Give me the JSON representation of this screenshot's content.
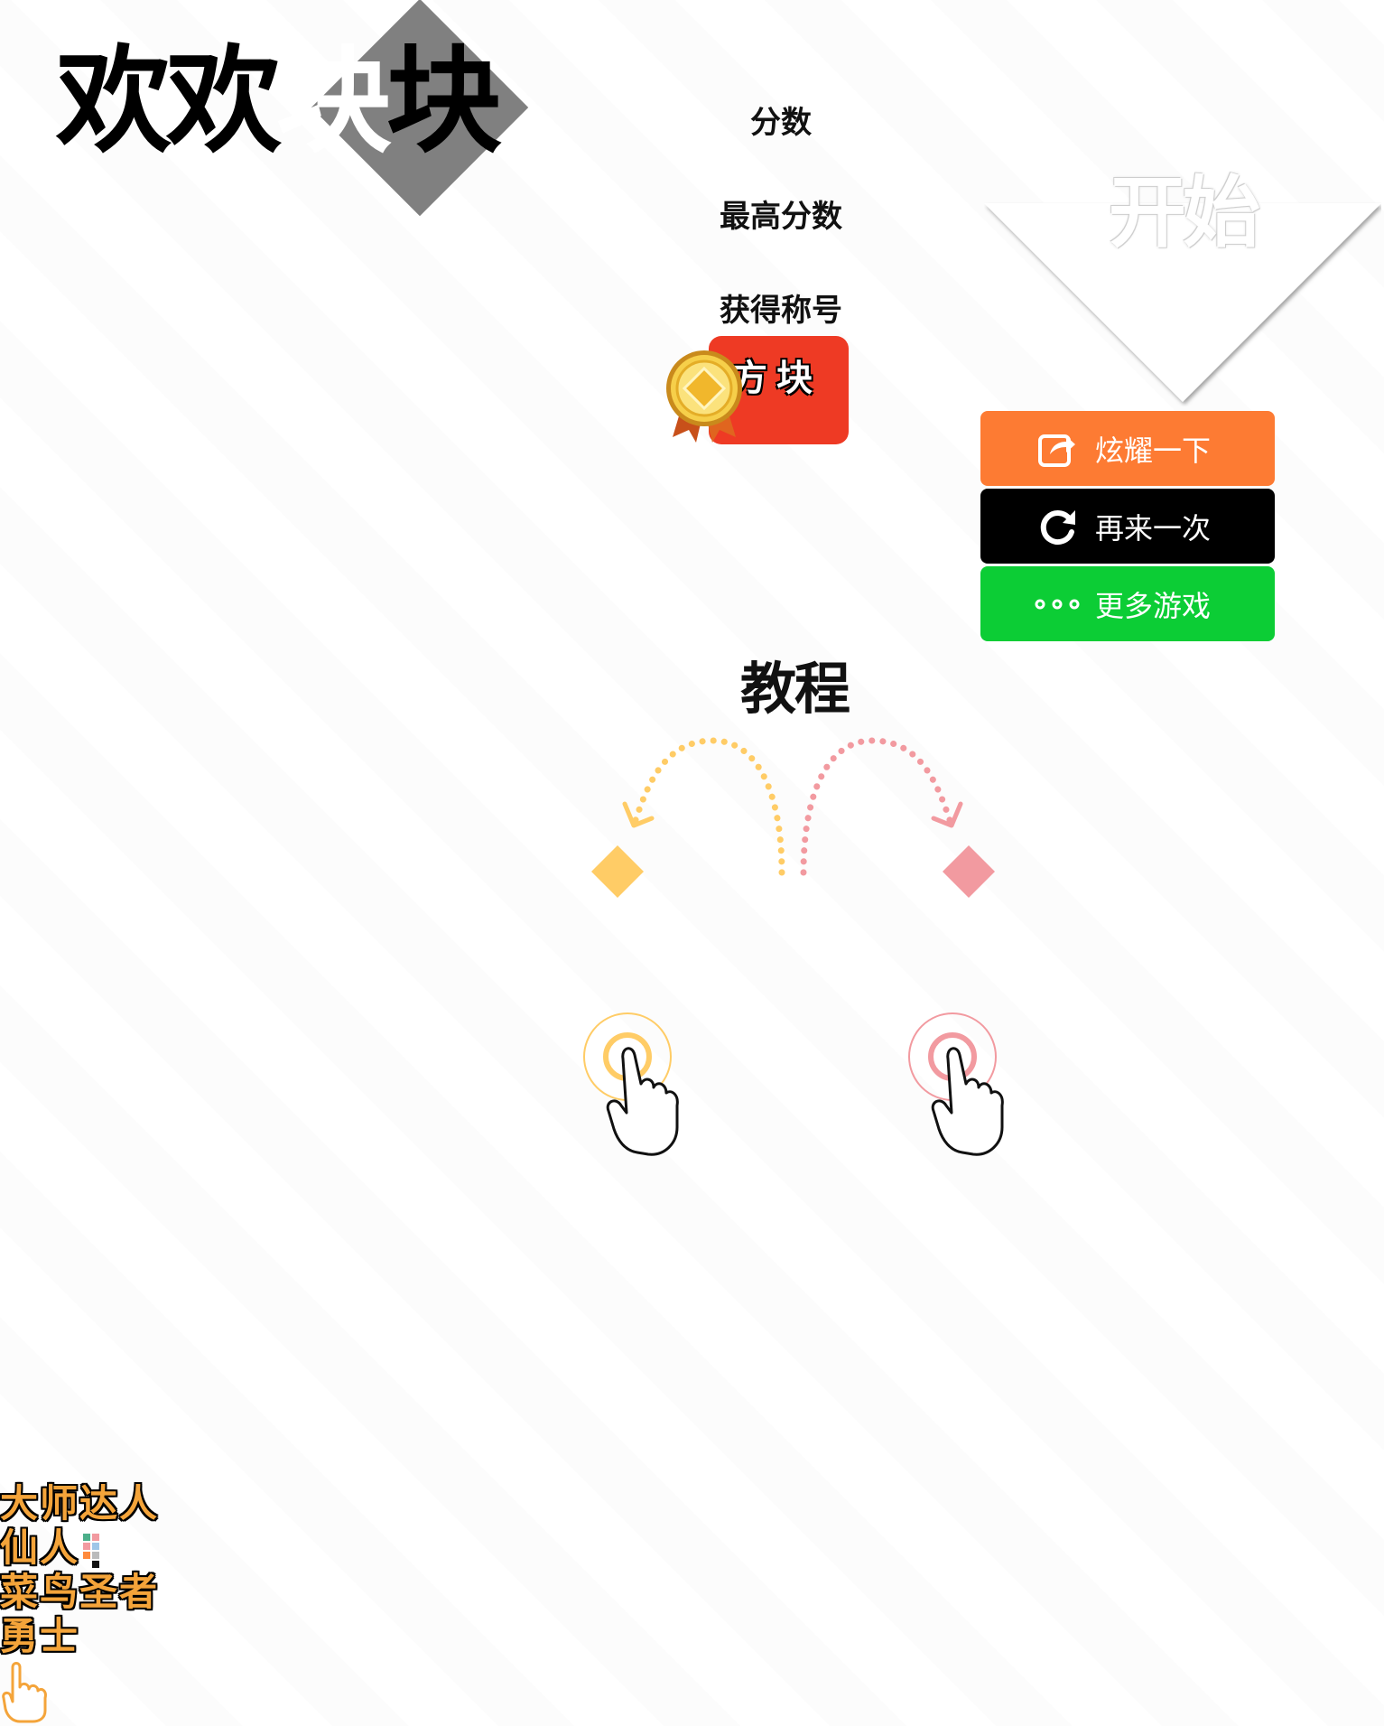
{
  "title": {
    "part1": "欢欢",
    "part2": "块",
    "part3": "块"
  },
  "labels": {
    "score": "分数",
    "best_score": "最高分数",
    "achievement": "获得称号"
  },
  "badge": {
    "text": "方块",
    "color": "#ee3a24"
  },
  "start": {
    "label": "开始"
  },
  "buttons": {
    "share": {
      "label": "炫耀一下",
      "icon": "share-icon",
      "color": "#fd7b33"
    },
    "retry": {
      "label": "再来一次",
      "icon": "refresh-icon",
      "color": "#000000"
    },
    "more": {
      "label": "更多游戏",
      "icon": "more-dots-icon",
      "color": "#0ccd35"
    }
  },
  "tutorial": {
    "heading": "教程",
    "left_color": "#ffcc66",
    "right_color": "#f29aa0"
  },
  "levels": [
    "大师达人",
    "仙人",
    "菜鸟圣者",
    "勇士"
  ]
}
